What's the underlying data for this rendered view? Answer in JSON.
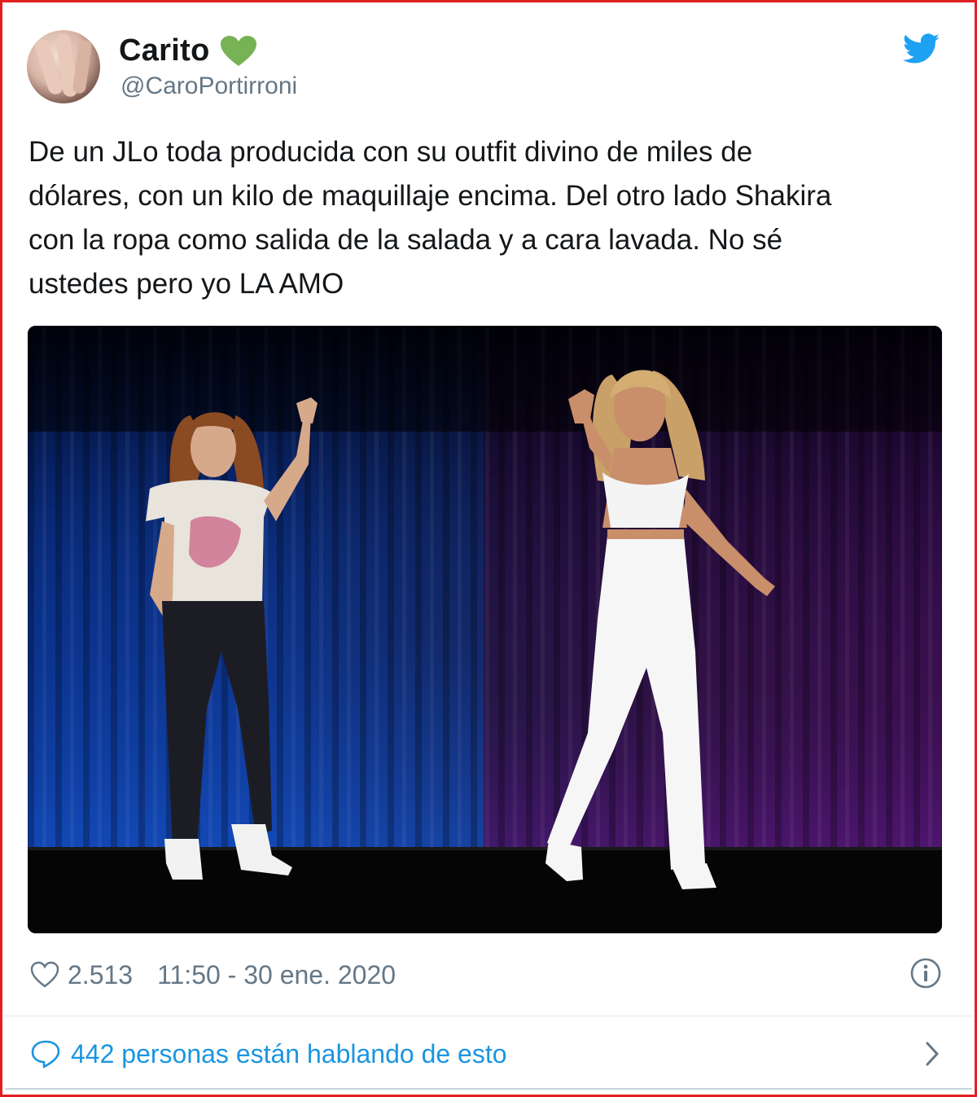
{
  "tweet": {
    "display_name": "Carito",
    "name_emoji": "green-heart-icon",
    "handle": "@CaroPortirroni",
    "text": "De un JLo toda producida con su outfit divino de miles de\ndólares, con un kilo de maquillaje encima. Del otro lado Shakira\ncon la ropa como salida de la salada y a cara lavada. No sé\nustedes pero yo LA AMO",
    "likes": "2.513",
    "timestamp": "11:50 - 30 ene. 2020",
    "conversation": "442 personas están hablando de esto"
  },
  "icons": {
    "brand": "twitter-bird-icon",
    "like": "heart-outline-icon",
    "info": "info-icon",
    "reply": "speech-bubble-icon",
    "chevron": "chevron-right-icon"
  },
  "colors": {
    "twitter_blue": "#1da1f2",
    "link_blue": "#1b95e0",
    "muted_gray": "#657786",
    "green_heart": "#77b255",
    "frame_red": "#e02020"
  }
}
